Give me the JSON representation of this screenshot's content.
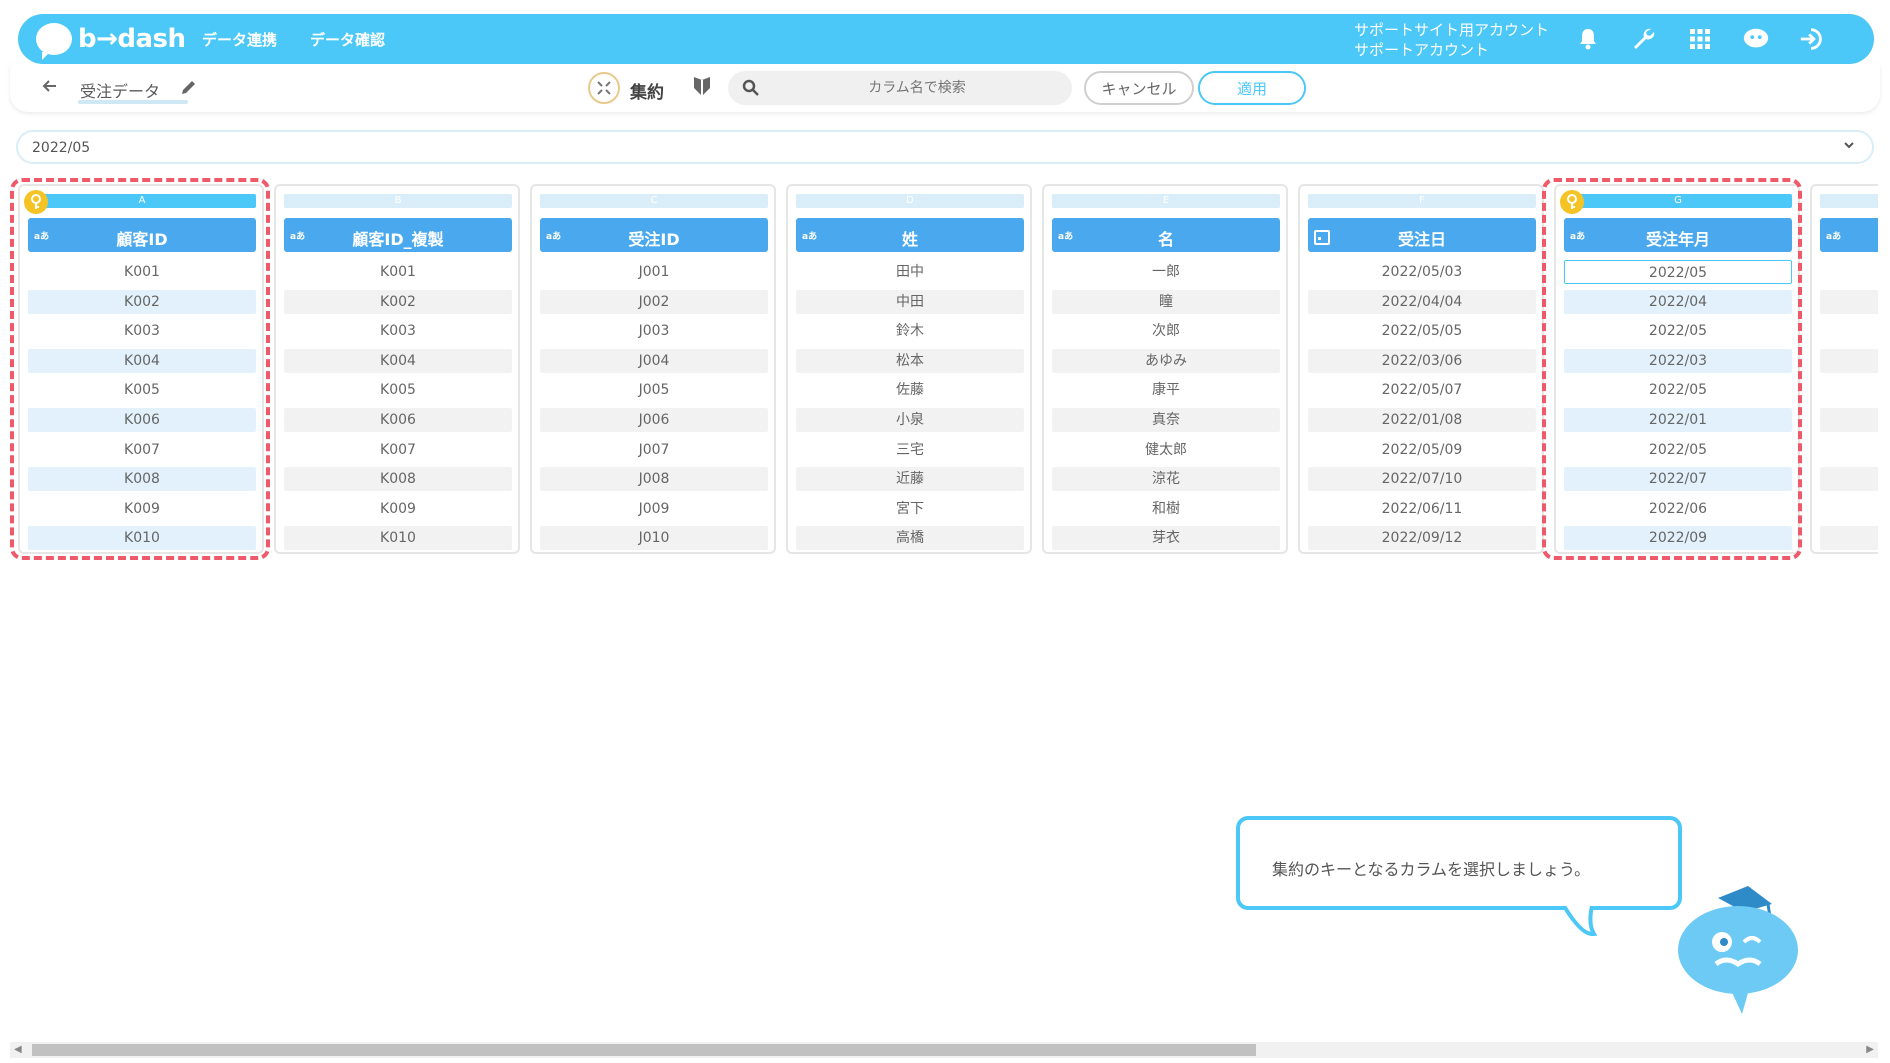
{
  "topbar": {
    "logo_text": "b→dash",
    "nav": [
      "データ連携",
      "データ確認"
    ],
    "account_line1": "サポートサイト用アカウント",
    "account_line2": "サポートアカウント"
  },
  "subbar": {
    "title": "受注データ",
    "aggregate_label": "集約",
    "search_placeholder": "カラム名で検索",
    "cancel_label": "キャンセル",
    "apply_label": "適用"
  },
  "filter": {
    "value": "2022/05"
  },
  "columns": [
    {
      "letter": "A",
      "type": "aあ",
      "name": "顧客ID",
      "key": true,
      "rows": [
        "K001",
        "K002",
        "K003",
        "K004",
        "K005",
        "K006",
        "K007",
        "K008",
        "K009",
        "K010"
      ]
    },
    {
      "letter": "B",
      "type": "aあ",
      "name": "顧客ID_複製",
      "key": false,
      "rows": [
        "K001",
        "K002",
        "K003",
        "K004",
        "K005",
        "K006",
        "K007",
        "K008",
        "K009",
        "K010"
      ]
    },
    {
      "letter": "C",
      "type": "aあ",
      "name": "受注ID",
      "key": false,
      "rows": [
        "J001",
        "J002",
        "J003",
        "J004",
        "J005",
        "J006",
        "J007",
        "J008",
        "J009",
        "J010"
      ]
    },
    {
      "letter": "D",
      "type": "aあ",
      "name": "姓",
      "key": false,
      "rows": [
        "田中",
        "中田",
        "鈴木",
        "松本",
        "佐藤",
        "小泉",
        "三宅",
        "近藤",
        "宮下",
        "高橋"
      ]
    },
    {
      "letter": "E",
      "type": "aあ",
      "name": "名",
      "key": false,
      "rows": [
        "一郎",
        "瞳",
        "次郎",
        "あゆみ",
        "康平",
        "真奈",
        "健太郎",
        "涼花",
        "和樹",
        "芽衣"
      ]
    },
    {
      "letter": "F",
      "type": "date",
      "name": "受注日",
      "key": false,
      "rows": [
        "2022/05/03",
        "2022/04/04",
        "2022/05/05",
        "2022/03/06",
        "2022/05/07",
        "2022/01/08",
        "2022/05/09",
        "2022/07/10",
        "2022/06/11",
        "2022/09/12"
      ]
    },
    {
      "letter": "G",
      "type": "aあ",
      "name": "受注年月",
      "key": true,
      "rows": [
        "2022/05",
        "2022/04",
        "2022/05",
        "2022/03",
        "2022/05",
        "2022/01",
        "2022/05",
        "2022/07",
        "2022/06",
        "2022/09"
      ]
    }
  ],
  "partial_column": {
    "type": "aあ"
  },
  "tooltip": {
    "text": "集約のキーとなるカラムを選択しましょう。"
  },
  "colors": {
    "accent": "#4cc8f8",
    "header": "#4aa9ee",
    "dash": "#ef5a6a",
    "key": "#f6c324"
  },
  "icons": [
    "bell-icon",
    "wrench-icon",
    "grid-icon",
    "chat-icon",
    "logout-icon",
    "back-arrow-icon",
    "pencil-icon",
    "aggregate-icon",
    "shield-icon",
    "search-icon",
    "chevron-down-icon",
    "key-icon",
    "calendar-icon"
  ]
}
